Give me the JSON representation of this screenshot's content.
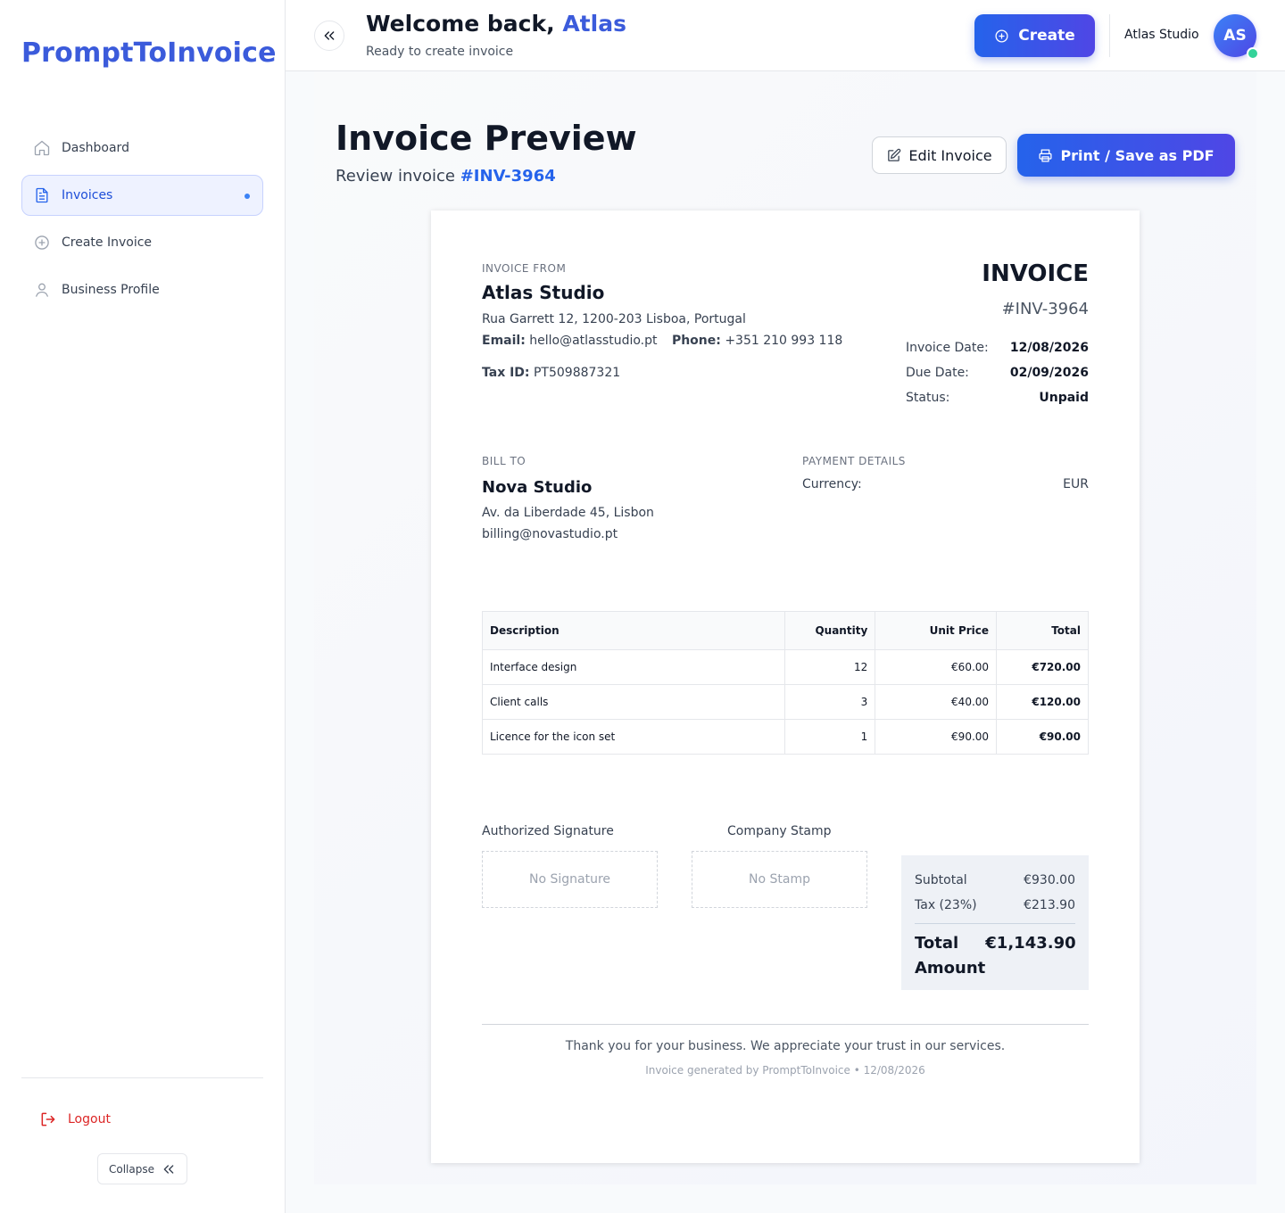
{
  "sidebar": {
    "logo": "PromptToInvoice",
    "items": [
      {
        "label": "Dashboard"
      },
      {
        "label": "Invoices"
      },
      {
        "label": "Create Invoice"
      },
      {
        "label": "Business Profile"
      }
    ],
    "logout": "Logout",
    "collapse": "Collapse"
  },
  "header": {
    "welcome_prefix": "Welcome back, ",
    "welcome_name": "Atlas",
    "subtitle": "Ready to create invoice",
    "create_label": "Create",
    "user_name": "Atlas Studio",
    "avatar_initials": "AS"
  },
  "page": {
    "title": "Invoice Preview",
    "subtitle_prefix": "Review invoice ",
    "invoice_ref": "#INV-3964",
    "edit_label": "Edit Invoice",
    "print_label": "Print / Save as PDF"
  },
  "invoice": {
    "from_label": "INVOICE FROM",
    "from_name": "Atlas Studio",
    "from_address": "Rua Garrett 12, 1200-203 Lisboa, Portugal",
    "email_label": "Email:",
    "email": "hello@atlasstudio.pt",
    "phone_label": "Phone:",
    "phone": "+351 210 993 118",
    "tax_label": "Tax ID:",
    "tax_id": "PT509887321",
    "heading": "INVOICE",
    "number": "#INV-3964",
    "meta": [
      {
        "key": "Invoice Date:",
        "value": "12/08/2026"
      },
      {
        "key": "Due Date:",
        "value": "02/09/2026"
      },
      {
        "key": "Status:",
        "value": "Unpaid"
      }
    ],
    "bill_label": "BILL TO",
    "bill_name": "Nova Studio",
    "bill_address": "Av. da Liberdade 45, Lisbon",
    "bill_email": "billing@novastudio.pt",
    "payment_label": "PAYMENT DETAILS",
    "currency_label": "Currency:",
    "currency": "EUR",
    "table_headers": [
      "Description",
      "Quantity",
      "Unit Price",
      "Total"
    ],
    "items": [
      {
        "description": "Interface design",
        "quantity": "12",
        "unit_price": "€60.00",
        "total": "€720.00"
      },
      {
        "description": "Client calls",
        "quantity": "3",
        "unit_price": "€40.00",
        "total": "€120.00"
      },
      {
        "description": "Licence for the icon set",
        "quantity": "1",
        "unit_price": "€90.00",
        "total": "€90.00"
      }
    ],
    "signature_label": "Authorized Signature",
    "signature_empty": "No Signature",
    "stamp_label": "Company Stamp",
    "stamp_empty": "No Stamp",
    "subtotal_label": "Subtotal",
    "subtotal": "€930.00",
    "tax_row_label": "Tax (23%)",
    "tax_amount": "€213.90",
    "total_label": "Total Amount",
    "total": "€1,143.90",
    "thanks": "Thank you for your business. We appreciate your trust in our services.",
    "generated": "Invoice generated by PromptToInvoice • 12/08/2026"
  },
  "colors": {
    "brand": "#3b5bdb",
    "accent": "#2563eb",
    "danger": "#dc2626",
    "online": "#34d399"
  },
  "icons": {
    "nav": [
      "home-icon",
      "document-icon",
      "plus-circle-icon",
      "user-icon"
    ],
    "logout": "logout-icon",
    "collapse": "chevrons-left-icon",
    "create": "plus-circle-icon",
    "edit": "edit-icon",
    "print": "printer-icon"
  }
}
